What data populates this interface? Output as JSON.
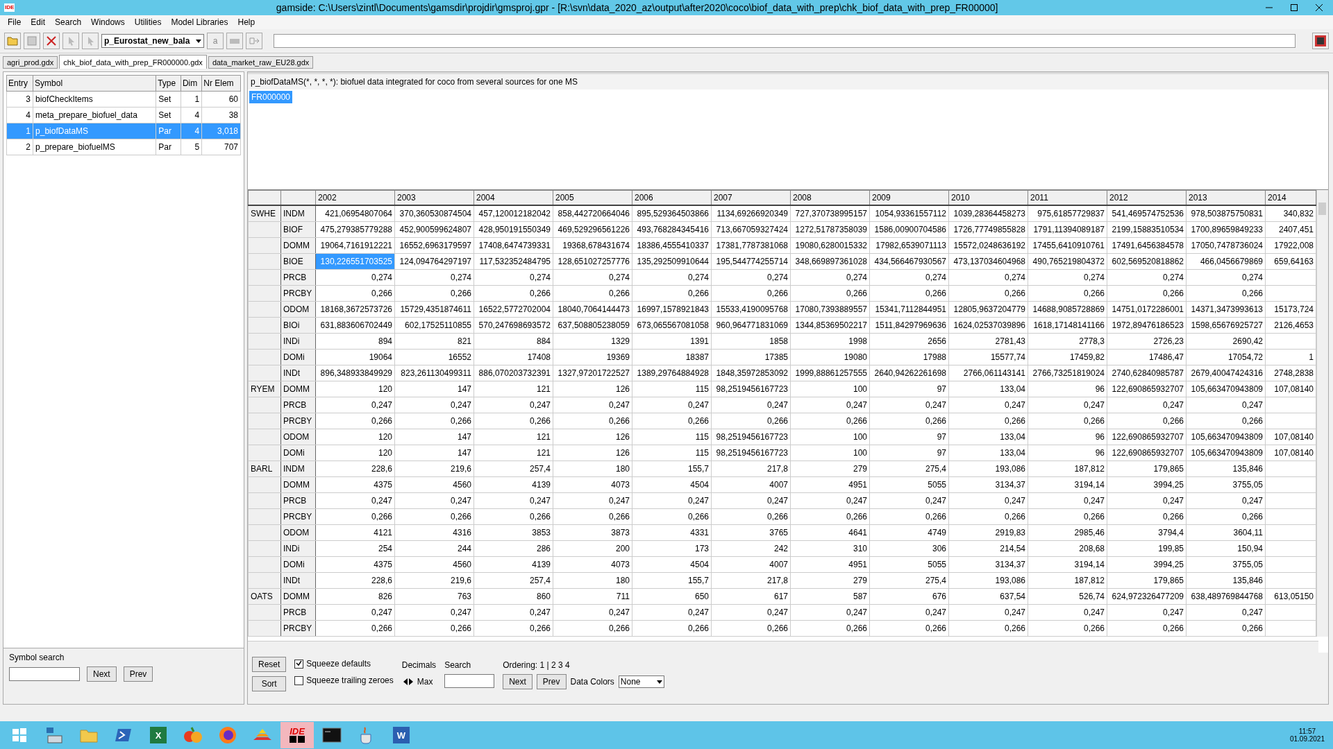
{
  "title": "gamside: C:\\Users\\zintl\\Documents\\gamsdir\\projdir\\gmsproj.gpr - [R:\\svn\\data_2020_az\\output\\after2020\\coco\\biof_data_with_prep\\chk_biof_data_with_prep_FR00000]",
  "app_badge": "IDE",
  "menu": [
    "File",
    "Edit",
    "Search",
    "Windows",
    "Utilities",
    "Model Libraries",
    "Help"
  ],
  "toolbar": {
    "symbol_combo": "p_Eurostat_new_bala",
    "letter_button": "a"
  },
  "file_tabs": [
    {
      "label": "agri_prod.gdx",
      "selected": false
    },
    {
      "label": "chk_biof_data_with_prep_FR000000.gdx",
      "selected": true
    },
    {
      "label": "data_market_raw_EU28.gdx",
      "selected": false
    }
  ],
  "symbols": {
    "columns": [
      "Entry",
      "Symbol",
      "Type",
      "Dim",
      "Nr Elem"
    ],
    "rows": [
      {
        "cells": [
          "3",
          "biofCheckItems",
          "Set",
          "1",
          "60"
        ],
        "selected": false
      },
      {
        "cells": [
          "4",
          "meta_prepare_biofuel_data",
          "Set",
          "4",
          "38"
        ],
        "selected": false
      },
      {
        "cells": [
          "1",
          "p_biofDataMS",
          "Par",
          "4",
          "3,018"
        ],
        "selected": true
      },
      {
        "cells": [
          "2",
          "p_prepare_biofuelMS",
          "Par",
          "5",
          "707"
        ],
        "selected": false
      }
    ]
  },
  "symbol_search": {
    "label": "Symbol search",
    "buttons": [
      "Next",
      "Prev"
    ]
  },
  "description": "p_biofDataMS(*, *, *, *): biofuel data integrated for coco from several sources for one MS",
  "filter_value": "FR000000",
  "data_table": {
    "columns": [
      "2002",
      "2003",
      "2004",
      "2005",
      "2006",
      "2007",
      "2008",
      "2009",
      "2010",
      "2011",
      "2012",
      "2013",
      "2014"
    ],
    "rows": [
      {
        "group": "SWHE",
        "item": "INDM",
        "values": [
          "421,06954807064",
          "370,360530874504",
          "457,120012182042",
          "858,442720664046",
          "895,529364503866",
          "1134,69266920349",
          "727,370738995157",
          "1054,93361557112",
          "1039,28364458273",
          "975,61857729837",
          "541,469574752536",
          "978,503875750831",
          "340,832"
        ]
      },
      {
        "item": "BIOF",
        "values": [
          "475,279385779288",
          "452,900599624807",
          "428,950191550349",
          "469,529296561226",
          "493,768284345416",
          "713,667059327424",
          "1272,51787358039",
          "1586,00900704586",
          "1726,77749855828",
          "1791,11394089187",
          "2199,15883510534",
          "1700,89659849233",
          "2407,451"
        ]
      },
      {
        "item": "DOMM",
        "values": [
          "19064,7161912221",
          "16552,6963179597",
          "17408,6474739331",
          "19368,678431674",
          "18386,4555410337",
          "17381,7787381068",
          "19080,6280015332",
          "17982,6539071113",
          "15572,0248636192",
          "17455,6410910761",
          "17491,6456384578",
          "17050,7478736024",
          "17922,008"
        ]
      },
      {
        "item": "BIOE",
        "values": [
          {
            "text": "130,226551703525",
            "selected": true
          },
          "124,094764297197",
          "117,532352484795",
          "128,651027257776",
          "135,292509910644",
          "195,544774255714",
          "348,669897361028",
          "434,566467930567",
          "473,137034604968",
          "490,765219804372",
          "602,569520818862",
          "466,0456679869",
          "659,64163"
        ]
      },
      {
        "item": "PRCB",
        "values": [
          "0,274",
          "0,274",
          "0,274",
          "0,274",
          "0,274",
          "0,274",
          "0,274",
          "0,274",
          "0,274",
          "0,274",
          "0,274",
          "0,274"
        ]
      },
      {
        "item": "PRCBY",
        "values": [
          "0,266",
          "0,266",
          "0,266",
          "0,266",
          "0,266",
          "0,266",
          "0,266",
          "0,266",
          "0,266",
          "0,266",
          "0,266",
          "0,266"
        ]
      },
      {
        "item": "ODOM",
        "values": [
          "18168,3672573726",
          "15729,4351874611",
          "16522,5772702004",
          "18040,7064144473",
          "16997,1578921843",
          "15533,4190095768",
          "17080,7393889557",
          "15341,7112844951",
          "12805,9637204779",
          "14688,9085728869",
          "14751,0172286001",
          "14371,3473993613",
          "15173,724"
        ]
      },
      {
        "item": "BIOi",
        "values": [
          "631,883606702449",
          "602,17525110855",
          "570,247698693572",
          "637,508805238059",
          "673,065567081058",
          "960,964771831069",
          "1344,85369502217",
          "1511,84297969636",
          "1624,02537039896",
          "1618,17148141166",
          "1972,89476186523",
          "1598,65676925727",
          "2126,4653"
        ]
      },
      {
        "item": "INDi",
        "values": [
          "894",
          "821",
          "884",
          "1329",
          "1391",
          "1858",
          "1998",
          "2656",
          "2781,43",
          "2778,3",
          "2726,23",
          "2690,42"
        ]
      },
      {
        "item": "DOMi",
        "values": [
          "19064",
          "16552",
          "17408",
          "19369",
          "18387",
          "17385",
          "19080",
          "17988",
          "15577,74",
          "17459,82",
          "17486,47",
          "17054,72",
          "1"
        ]
      },
      {
        "item": "INDt",
        "values": [
          "896,348933849929",
          "823,261130499311",
          "886,070203732391",
          "1327,97201722527",
          "1389,29764884928",
          "1848,35972853092",
          "1999,88861257555",
          "2640,94262261698",
          "2766,061143141",
          "2766,73251819024",
          "2740,62840985787",
          "2679,40047424316",
          "2748,2838"
        ]
      },
      {
        "group": "RYEM",
        "item": "DOMM",
        "values": [
          "120",
          "147",
          "121",
          "126",
          "115",
          "98,2519456167723",
          "100",
          "97",
          "133,04",
          "96",
          "122,690865932707",
          "105,663470943809",
          "107,08140"
        ]
      },
      {
        "item": "PRCB",
        "values": [
          "0,247",
          "0,247",
          "0,247",
          "0,247",
          "0,247",
          "0,247",
          "0,247",
          "0,247",
          "0,247",
          "0,247",
          "0,247",
          "0,247"
        ]
      },
      {
        "item": "PRCBY",
        "values": [
          "0,266",
          "0,266",
          "0,266",
          "0,266",
          "0,266",
          "0,266",
          "0,266",
          "0,266",
          "0,266",
          "0,266",
          "0,266",
          "0,266"
        ]
      },
      {
        "item": "ODOM",
        "values": [
          "120",
          "147",
          "121",
          "126",
          "115",
          "98,2519456167723",
          "100",
          "97",
          "133,04",
          "96",
          "122,690865932707",
          "105,663470943809",
          "107,08140"
        ]
      },
      {
        "item": "DOMi",
        "values": [
          "120",
          "147",
          "121",
          "126",
          "115",
          "98,2519456167723",
          "100",
          "97",
          "133,04",
          "96",
          "122,690865932707",
          "105,663470943809",
          "107,08140"
        ]
      },
      {
        "group": "BARL",
        "item": "INDM",
        "values": [
          "228,6",
          "219,6",
          "257,4",
          "180",
          "155,7",
          "217,8",
          "279",
          "275,4",
          "193,086",
          "187,812",
          "179,865",
          "135,846"
        ]
      },
      {
        "item": "DOMM",
        "values": [
          "4375",
          "4560",
          "4139",
          "4073",
          "4504",
          "4007",
          "4951",
          "5055",
          "3134,37",
          "3194,14",
          "3994,25",
          "3755,05"
        ]
      },
      {
        "item": "PRCB",
        "values": [
          "0,247",
          "0,247",
          "0,247",
          "0,247",
          "0,247",
          "0,247",
          "0,247",
          "0,247",
          "0,247",
          "0,247",
          "0,247",
          "0,247"
        ]
      },
      {
        "item": "PRCBY",
        "values": [
          "0,266",
          "0,266",
          "0,266",
          "0,266",
          "0,266",
          "0,266",
          "0,266",
          "0,266",
          "0,266",
          "0,266",
          "0,266",
          "0,266"
        ]
      },
      {
        "item": "ODOM",
        "values": [
          "4121",
          "4316",
          "3853",
          "3873",
          "4331",
          "3765",
          "4641",
          "4749",
          "2919,83",
          "2985,46",
          "3794,4",
          "3604,11"
        ]
      },
      {
        "item": "INDi",
        "values": [
          "254",
          "244",
          "286",
          "200",
          "173",
          "242",
          "310",
          "306",
          "214,54",
          "208,68",
          "199,85",
          "150,94"
        ]
      },
      {
        "item": "DOMi",
        "values": [
          "4375",
          "4560",
          "4139",
          "4073",
          "4504",
          "4007",
          "4951",
          "5055",
          "3134,37",
          "3194,14",
          "3994,25",
          "3755,05"
        ]
      },
      {
        "item": "INDt",
        "values": [
          "228,6",
          "219,6",
          "257,4",
          "180",
          "155,7",
          "217,8",
          "279",
          "275,4",
          "193,086",
          "187,812",
          "179,865",
          "135,846"
        ]
      },
      {
        "group": "OATS",
        "item": "DOMM",
        "values": [
          "826",
          "763",
          "860",
          "711",
          "650",
          "617",
          "587",
          "676",
          "637,54",
          "526,74",
          "624,972326477209",
          "638,489769844768",
          "613,05150"
        ]
      },
      {
        "item": "PRCB",
        "values": [
          "0,247",
          "0,247",
          "0,247",
          "0,247",
          "0,247",
          "0,247",
          "0,247",
          "0,247",
          "0,247",
          "0,247",
          "0,247",
          "0,247"
        ]
      },
      {
        "item": "PRCBY",
        "values": [
          "0,266",
          "0,266",
          "0,266",
          "0,266",
          "0,266",
          "0,266",
          "0,266",
          "0,266",
          "0,266",
          "0,266",
          "0,266",
          "0,266"
        ]
      }
    ]
  },
  "controls": {
    "reset": "Reset",
    "sort": "Sort",
    "checkboxes": [
      {
        "label": "Squeeze defaults",
        "checked": true
      },
      {
        "label": "Squeeze trailing zeroes",
        "checked": false
      }
    ],
    "decimals": "Decimals",
    "max": "Max",
    "search": "Search",
    "ordering": "Ordering: 1 | 2 3 4",
    "next": "Next",
    "prev": "Prev",
    "data_colors": "Data Colors",
    "data_colors_value": "None"
  },
  "taskbar": {
    "apps": [
      {
        "kind": "windows"
      },
      {
        "kind": "server"
      },
      {
        "kind": "folder"
      },
      {
        "kind": "shell"
      },
      {
        "kind": "sheet",
        "glyph": "X"
      },
      {
        "kind": "fruit"
      },
      {
        "kind": "browser"
      },
      {
        "kind": "layers"
      },
      {
        "kind": "ide",
        "glyph": "IDE",
        "selected": true
      },
      {
        "kind": "console"
      },
      {
        "kind": "cup"
      },
      {
        "kind": "doc",
        "glyph": "W"
      }
    ],
    "time": "11:57",
    "date": "01.09.2021"
  }
}
